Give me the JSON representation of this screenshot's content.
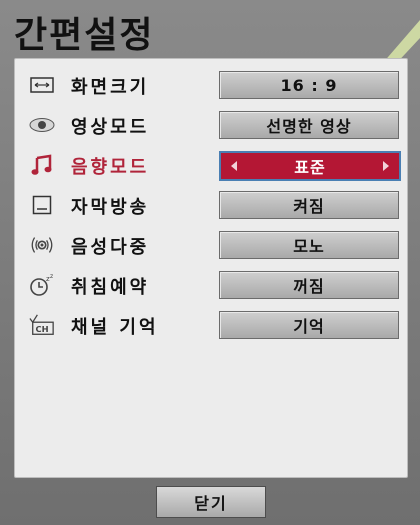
{
  "title": "간편설정",
  "rows": [
    {
      "label": "화면크기",
      "value": "16 : 9",
      "icon": "aspect-ratio-icon"
    },
    {
      "label": "영상모드",
      "value": "선명한 영상",
      "icon": "eye-icon"
    },
    {
      "label": "음향모드",
      "value": "표준",
      "icon": "music-note-icon",
      "selected": true
    },
    {
      "label": "자막방송",
      "value": "켜짐",
      "icon": "caption-icon"
    },
    {
      "label": "음성다중",
      "value": "모노",
      "icon": "audio-signal-icon"
    },
    {
      "label": "취침예약",
      "value": "꺼짐",
      "icon": "sleep-timer-icon"
    },
    {
      "label": "채널 기억",
      "value": "기억",
      "icon": "channel-memory-icon"
    }
  ],
  "close_label": "닫기",
  "colors": {
    "selected_value_bg": "#b41734",
    "selected_border": "#4a7fb3",
    "active_label": "#b0243a"
  }
}
